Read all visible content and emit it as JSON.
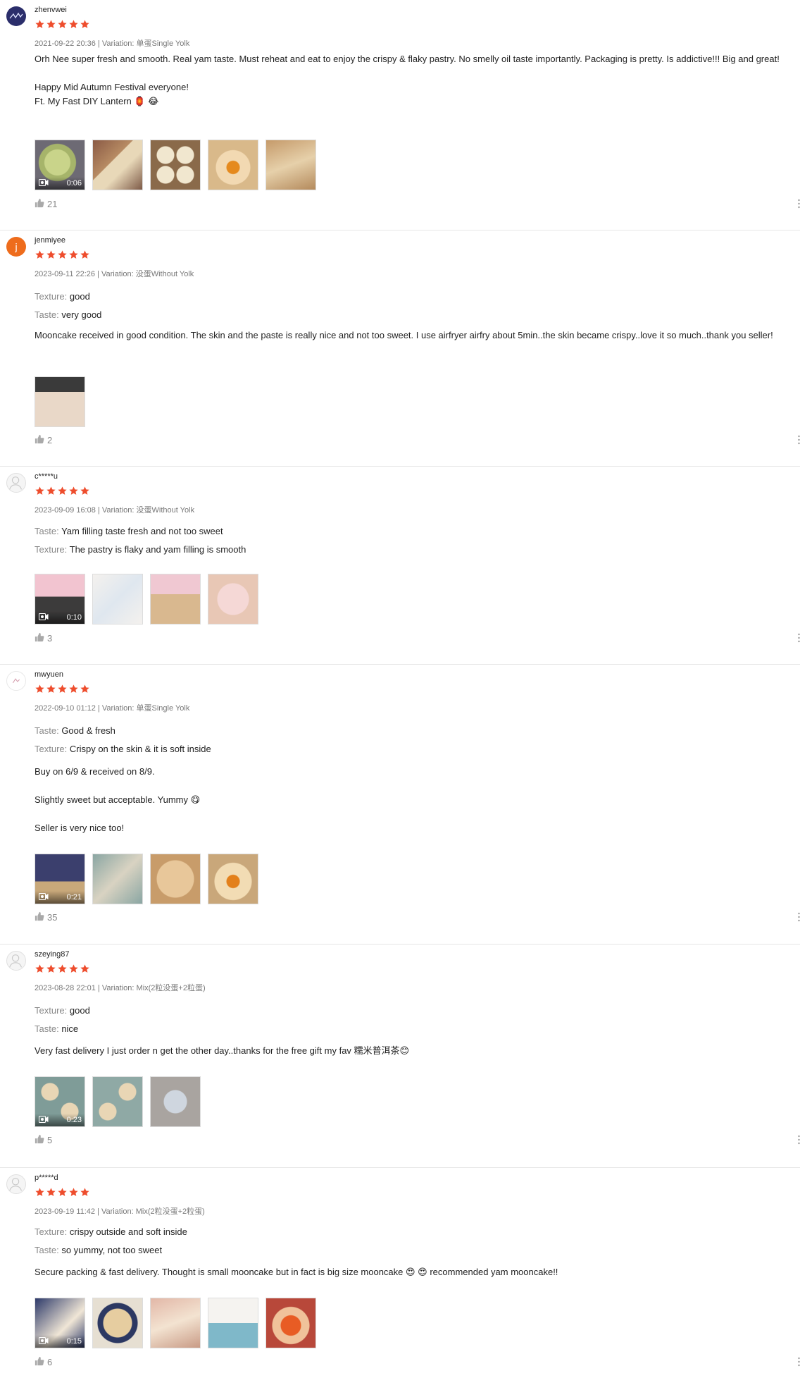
{
  "colors": {
    "star": "#ee4d2d",
    "meta": "#777777",
    "divider": "#e6e6e6"
  },
  "icons": {
    "star": "star-icon",
    "thumb": "thumbs-up-icon",
    "video": "video-camera-icon",
    "avatar": "user-avatar-icon"
  },
  "reviews": [
    {
      "username": "zhenvwei",
      "rating": 5,
      "meta": "2021-09-22 20:36 | Variation: 单蛋Single Yolk",
      "text": [
        "Orh Nee super fresh and smooth. Real yam taste. Must reheat and eat to enjoy the crispy & flaky pastry. No smelly oil taste importantly. Packaging is pretty. Is addictive!!! Big and great!",
        "",
        "Happy Mid Autumn Festival everyone!",
        "Ft. My Fast DIY Lantern 🏮 😂"
      ],
      "video_duration": "0:06",
      "likes": "21"
    },
    {
      "username": "jenmiyee",
      "avatar_letter": "j",
      "rating": 5,
      "meta": "2023-09-11 22:26 | Variation: 没蛋Without Yolk",
      "attrs": [
        {
          "key": "Texture:",
          "value": "good"
        },
        {
          "key": "Taste:",
          "value": "very good"
        }
      ],
      "text": [
        "Mooncake received in good condition. The skin and the paste is really nice and not too sweet. I use airfryer airfry about 5min..the skin became crispy..love it so much..thank you seller!"
      ],
      "likes": "2"
    },
    {
      "username": "c*****u",
      "rating": 5,
      "meta": "2023-09-09 16:08 | Variation: 没蛋Without Yolk",
      "attrs": [
        {
          "key": "Taste:",
          "value": "Yam filling taste fresh and not too sweet"
        },
        {
          "key": "Texture:",
          "value": "The pastry is flaky and yam filling is smooth"
        }
      ],
      "video_duration": "0:10",
      "likes": "3"
    },
    {
      "username": "mwyuen",
      "rating": 5,
      "meta": "2022-09-10 01:12 | Variation: 单蛋Single Yolk",
      "attrs": [
        {
          "key": "Taste:",
          "value": "Good & fresh"
        },
        {
          "key": "Texture:",
          "value": "Crispy on the skin & it is soft inside"
        }
      ],
      "text": [
        "Buy on 6/9 & received on 8/9.",
        "",
        "Slightly sweet but acceptable. Yummy 😋",
        "",
        "Seller is very nice too!"
      ],
      "video_duration": "0:21",
      "likes": "35"
    },
    {
      "username": "szeying87",
      "rating": 5,
      "meta": "2023-08-28 22:01 | Variation: Mix(2粒没蛋+2粒蛋)",
      "attrs": [
        {
          "key": "Texture:",
          "value": "good"
        },
        {
          "key": "Taste:",
          "value": "nice"
        }
      ],
      "text": [
        "Very fast delivery I just order n get the other day..thanks for the free gift my fav 糯米普洱茶😊"
      ],
      "video_duration": "0:23",
      "likes": "5"
    },
    {
      "username": "p*****d",
      "rating": 5,
      "meta": "2023-09-19 11:42 | Variation: Mix(2粒没蛋+2粒蛋)",
      "attrs": [
        {
          "key": "Texture:",
          "value": "crispy outside and soft inside"
        },
        {
          "key": "Taste:",
          "value": "so yummy, not too sweet"
        }
      ],
      "text": [
        "Secure packing & fast delivery. Thought is small mooncake but in fact is big size mooncake 😍 😍 recommended yam mooncake!!"
      ],
      "video_duration": "0:15",
      "likes": "6"
    }
  ]
}
